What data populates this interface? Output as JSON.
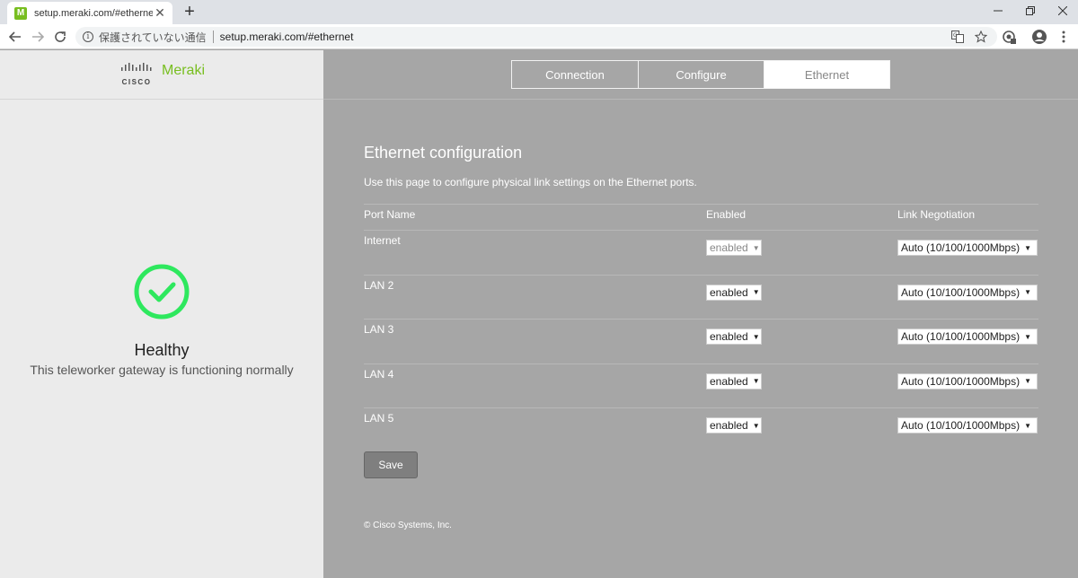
{
  "browser": {
    "tab_title": "setup.meraki.com/#ethernet",
    "favicon_letter": "M",
    "tab_close": "✕",
    "new_tab": "+",
    "security_text": "保護されていない通信",
    "url": "setup.meraki.com/#ethernet",
    "window_controls": [
      "minimize-icon",
      "restore-icon",
      "close-icon"
    ],
    "icons": [
      "back-arrow-icon",
      "forward-arrow-icon",
      "reload-icon",
      "info-icon",
      "translate-icon",
      "star-icon",
      "extension-icon",
      "account-icon",
      "menu-icon"
    ]
  },
  "brand": {
    "cisco": "CISCO",
    "meraki": "Meraki",
    "accent": "#78be20"
  },
  "health": {
    "title": "Healthy",
    "subtitle": "This teleworker gateway is functioning normally",
    "color": "#2ee85e"
  },
  "nav_tabs": [
    {
      "label": "Connection",
      "active": false
    },
    {
      "label": "Configure",
      "active": false
    },
    {
      "label": "Ethernet",
      "active": true
    }
  ],
  "main": {
    "title": "Ethernet configuration",
    "description": "Use this page to configure physical link settings on the Ethernet ports.",
    "columns": {
      "port_name": "Port Name",
      "enabled": "Enabled",
      "link": "Link Negotiation"
    },
    "rows": [
      {
        "name": "Internet",
        "enabled": "enabled",
        "link": "Auto (10/100/1000Mbps)",
        "enabled_disabled": true
      },
      {
        "name": "LAN 2",
        "enabled": "enabled",
        "link": "Auto (10/100/1000Mbps)",
        "enabled_disabled": false
      },
      {
        "name": "LAN 3",
        "enabled": "enabled",
        "link": "Auto (10/100/1000Mbps)",
        "enabled_disabled": false
      },
      {
        "name": "LAN 4",
        "enabled": "enabled",
        "link": "Auto (10/100/1000Mbps)",
        "enabled_disabled": false
      },
      {
        "name": "LAN 5",
        "enabled": "enabled",
        "link": "Auto (10/100/1000Mbps)",
        "enabled_disabled": false
      }
    ],
    "save_label": "Save",
    "footer": "© Cisco Systems, Inc."
  }
}
